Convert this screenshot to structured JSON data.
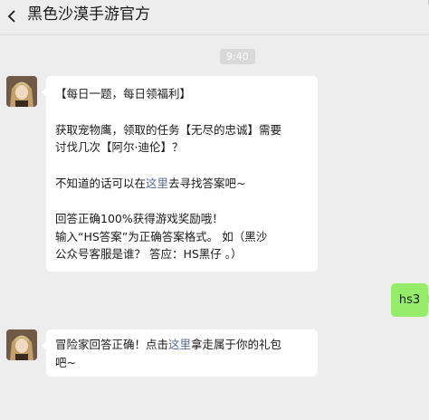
{
  "header": {
    "title": "黑色沙漠手游官方"
  },
  "time_label": "9:40",
  "messages": {
    "m1": {
      "line1": "【每日一题，每日领福利】",
      "line2": "获取宠物鹰，领取的任务【无尽的忠诚】需要",
      "line3": "讨伐几次【阿尔·迪伦】？",
      "line4_pre": "不知道的话可以在",
      "line4_link": "这里",
      "line4_post": "去寻找答案吧~",
      "line5": "回答正确100%获得游戏奖励哦！",
      "line6": "输入“HS答案”为正确答案格式。 如（黑沙",
      "line7": "公众号客服是谁？ 答应：HS黑仔 。）"
    },
    "m2": {
      "text": "hs3"
    },
    "m3": {
      "pre": "冒险家回答正确！点击",
      "link": "这里",
      "post": "拿走属于你的礼包",
      "line2": "吧~"
    }
  },
  "colors": {
    "background": "#ededed",
    "bubble_self": "#95ec69",
    "link": "#576b95"
  }
}
